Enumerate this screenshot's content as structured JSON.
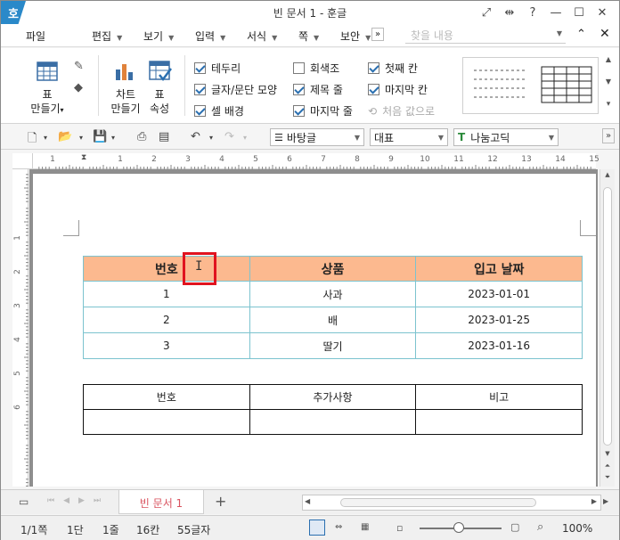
{
  "window": {
    "logo": "호",
    "title": "빈 문서 1 - 훈글"
  },
  "title_buttons": [
    "⤢",
    "⇹",
    "?",
    "—",
    "☐",
    "✕"
  ],
  "menu": {
    "items": [
      "파일",
      "편집",
      "보기",
      "입력",
      "서식",
      "쪽",
      "보안"
    ],
    "search_placeholder": "찾을 내용",
    "more_icon": "»"
  },
  "ribbon": {
    "table_button": "표\n만들기",
    "table_button_line1": "표",
    "table_button_line2": "만들기",
    "chart_button_line1": "차트",
    "chart_button_line2": "만들기",
    "props_button_line1": "표",
    "props_button_line2": "속성",
    "checks": [
      {
        "label": "테두리",
        "checked": true
      },
      {
        "label": "글자/문단 모양",
        "checked": true
      },
      {
        "label": "셀 배경",
        "checked": true
      },
      {
        "label": "회색조",
        "checked": false
      },
      {
        "label": "제목 줄",
        "checked": true
      },
      {
        "label": "마지막 줄",
        "checked": true
      },
      {
        "label": "첫째 칸",
        "checked": true
      },
      {
        "label": "마지막 칸",
        "checked": true
      }
    ],
    "reset_label": "처음 값으로"
  },
  "toolbar": {
    "style_combo": "바탕글",
    "para_combo": "대표",
    "font_combo": "나눔고딕"
  },
  "ruler": {
    "h_ticks": [
      "1",
      "1",
      "2",
      "3",
      "4",
      "5",
      "6",
      "7",
      "8",
      "9",
      "10",
      "11",
      "12",
      "13",
      "14",
      "15"
    ],
    "v_ticks": [
      "1",
      "2",
      "3",
      "4",
      "5",
      "6"
    ]
  },
  "table1": {
    "headers": [
      "번호",
      "상품",
      "입고 날짜"
    ],
    "rows": [
      [
        "1",
        "사과",
        "2023-01-01"
      ],
      [
        "2",
        "배",
        "2023-01-25"
      ],
      [
        "3",
        "딸기",
        "2023-01-16"
      ]
    ]
  },
  "table2": {
    "headers": [
      "번호",
      "추가사항",
      "비고"
    ]
  },
  "tabs": {
    "active_tab": "빈 문서 1",
    "add_icon": "+"
  },
  "status": {
    "page": "1/1쪽",
    "column": "1단",
    "line": "1줄",
    "char_pos": "16칸",
    "char_count": "55글자",
    "zoom": "100%"
  },
  "colors": {
    "accent": "#2a89c9",
    "table_header": "#fcb98f",
    "table_border": "#7cc3cf",
    "highlight": "#e0141f",
    "tab_text": "#d9535f"
  }
}
